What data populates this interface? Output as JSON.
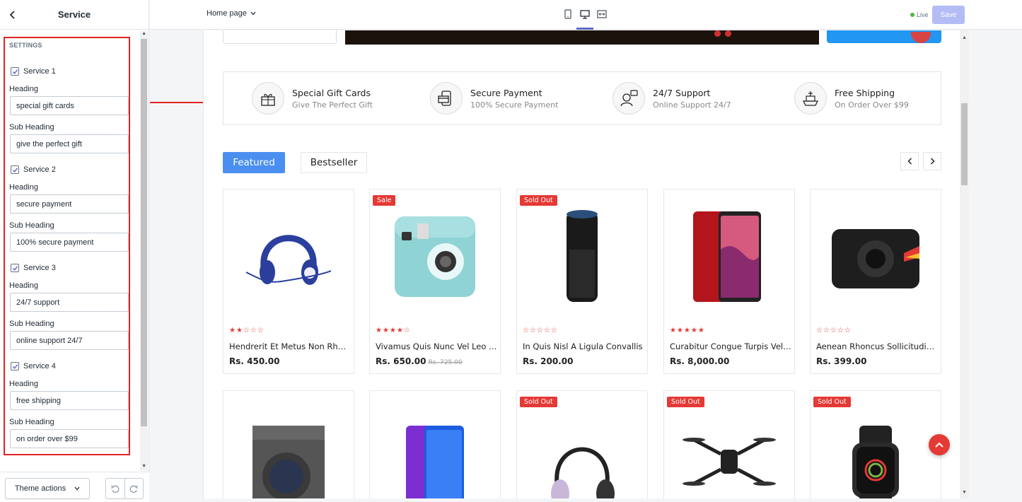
{
  "sidebar": {
    "title": "Service",
    "settings_label": "SETTINGS",
    "services": [
      {
        "checkbox_label": "Service 1",
        "heading_label": "Heading",
        "heading_value": "special gift cards",
        "subheading_label": "Sub Heading",
        "subheading_value": "give the perfect gift",
        "checked": true
      },
      {
        "checkbox_label": "Service 2",
        "heading_label": "Heading",
        "heading_value": "secure payment",
        "subheading_label": "Sub Heading",
        "subheading_value": "100% secure payment",
        "checked": true
      },
      {
        "checkbox_label": "Service 3",
        "heading_label": "Heading",
        "heading_value": "24/7 support",
        "subheading_label": "Sub Heading",
        "subheading_value": "online support 24/7",
        "checked": true
      },
      {
        "checkbox_label": "Service 4",
        "heading_label": "Heading",
        "heading_value": "free shipping",
        "subheading_label": "Sub Heading",
        "subheading_value": "on order over $99",
        "checked": true
      }
    ],
    "theme_actions_label": "Theme actions"
  },
  "topbar": {
    "page_select": "Home page",
    "live_label": "Live",
    "save_label": "Save"
  },
  "preview": {
    "services": [
      {
        "title": "Special Gift Cards",
        "subtitle": "Give The Perfect Gift",
        "icon": "gift-icon"
      },
      {
        "title": "Secure Payment",
        "subtitle": "100% Secure Payment",
        "icon": "payment-icon"
      },
      {
        "title": "24/7 Support",
        "subtitle": "Online Support 24/7",
        "icon": "support-icon"
      },
      {
        "title": "Free Shipping",
        "subtitle": "On Order Over $99",
        "icon": "ship-icon"
      }
    ],
    "tabs": [
      "Featured",
      "Bestseller"
    ],
    "products_row1": [
      {
        "name": "Hendrerit Et Metus Non Rhoncus",
        "price": "Rs. 450.00",
        "old_price": "",
        "badge": "",
        "rating": 2
      },
      {
        "name": "Vivamus Quis Nunc Vel Leo Lacinia",
        "price": "Rs. 650.00",
        "old_price": "Rs. 725.00",
        "badge": "Sale",
        "rating": 3.5
      },
      {
        "name": "In Quis Nisl A Ligula Convallis",
        "price": "Rs. 200.00",
        "old_price": "",
        "badge": "Sold Out",
        "rating": 0
      },
      {
        "name": "Curabitur Congue Turpis Vel Nisi",
        "price": "Rs. 8,000.00",
        "old_price": "",
        "badge": "",
        "rating": 5
      },
      {
        "name": "Aenean Rhoncus Sollicitudin Mauris",
        "price": "Rs. 399.00",
        "old_price": "",
        "badge": "",
        "rating": 0
      }
    ],
    "products_row2": [
      {
        "badge": ""
      },
      {
        "badge": ""
      },
      {
        "badge": "Sold Out"
      },
      {
        "badge": "Sold Out"
      },
      {
        "badge": "Sold Out"
      }
    ]
  },
  "colors": {
    "accent_red": "#e53935",
    "tab_blue": "#4a8ff0",
    "save_disabled": "#b3bcf5",
    "live_green": "#50b83c",
    "annotation_red": "#e02424"
  }
}
